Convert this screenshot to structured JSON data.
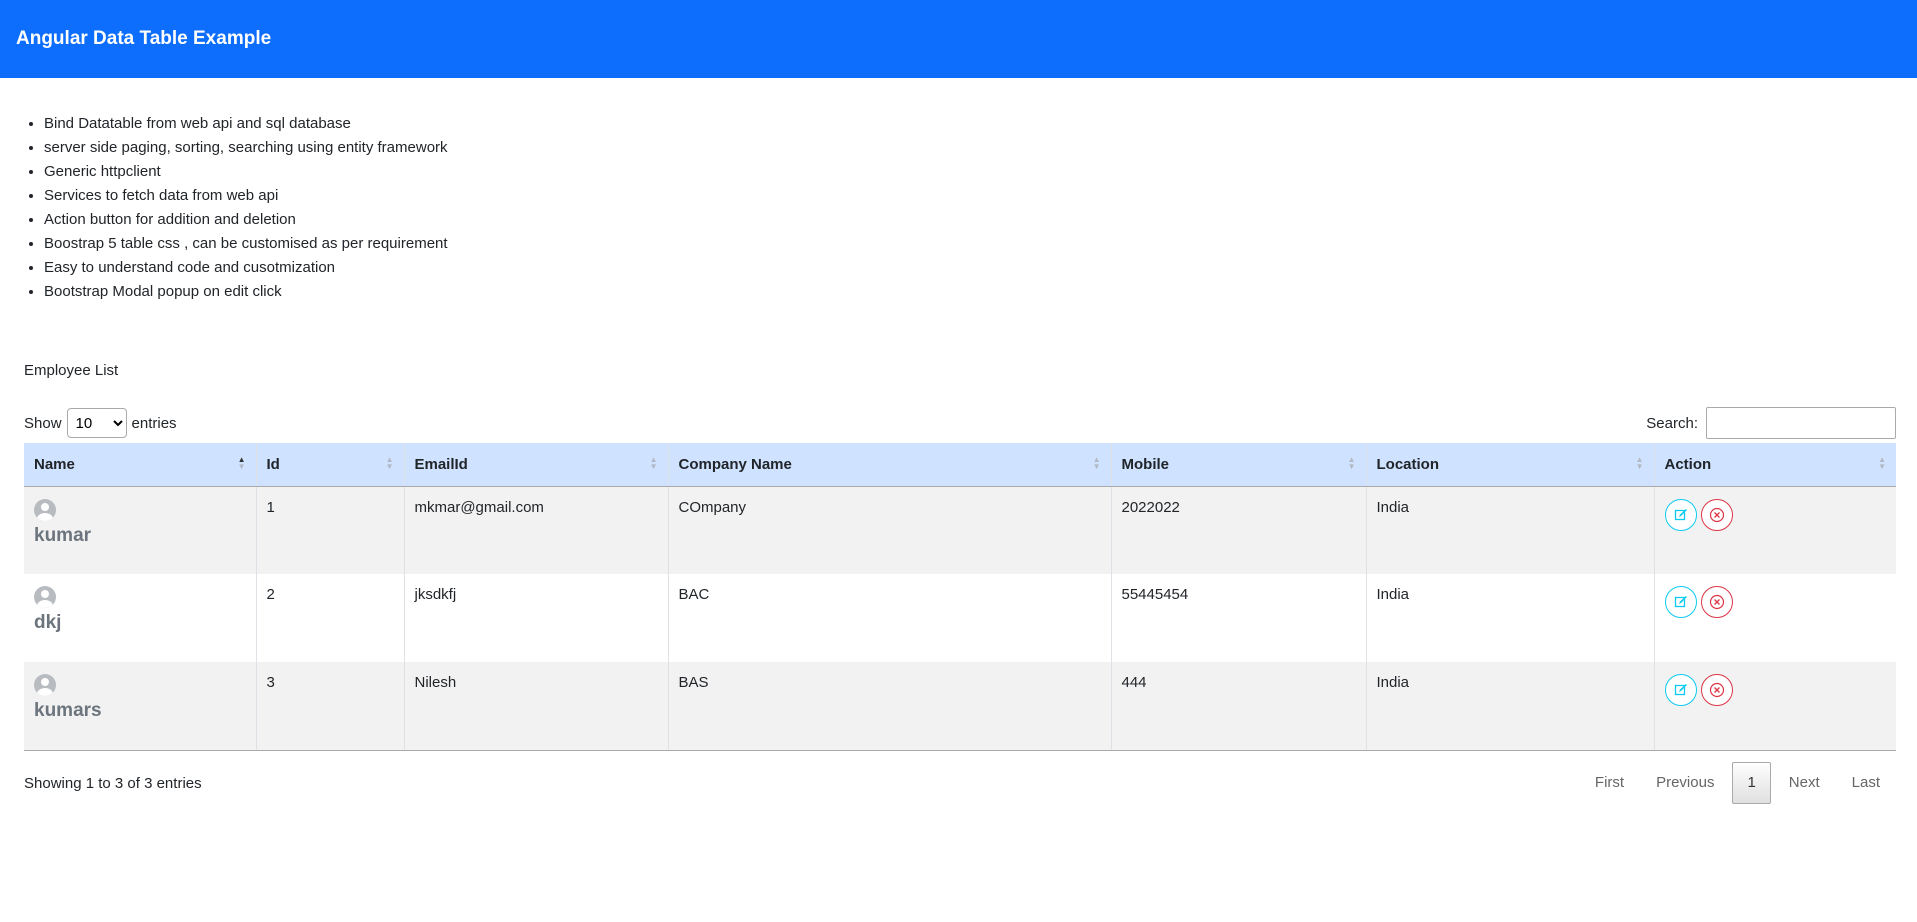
{
  "navbar": {
    "brand": "Angular Data Table Example"
  },
  "features": [
    "Bind Datatable from web api and sql database",
    "server side paging, sorting, searching using entity framework",
    "Generic httpclient",
    "Services to fetch data from web api",
    "Action button for addition and deletion",
    "Boostrap 5 table css , can be customised as per requirement",
    "Easy to understand code and cusotmization",
    "Bootstrap Modal popup on edit click"
  ],
  "section_title": "Employee List",
  "length": {
    "show_label": "Show",
    "value": "10",
    "entries_label": "entries"
  },
  "search": {
    "label": "Search:",
    "value": ""
  },
  "table": {
    "headers": [
      "Name",
      "Id",
      "EmailId",
      "Company Name",
      "Mobile",
      "Location",
      "Action"
    ],
    "rows": [
      {
        "name": "kumar",
        "id": "1",
        "email": "mkmar@gmail.com",
        "company": "COmpany",
        "mobile": "2022022",
        "location": "India"
      },
      {
        "name": "dkj",
        "id": "2",
        "email": "jksdkfj",
        "company": "BAC",
        "mobile": "55445454",
        "location": "India"
      },
      {
        "name": "kumars",
        "id": "3",
        "email": "Nilesh",
        "company": "BAS",
        "mobile": "444",
        "location": "India"
      }
    ]
  },
  "info": "Showing 1 to 3 of 3 entries",
  "pagination": {
    "first": "First",
    "previous": "Previous",
    "current": "1",
    "next": "Next",
    "last": "Last"
  },
  "colors": {
    "brand": "#0d6efd",
    "header_row": "#cfe2ff",
    "edit": "#0dcaf0",
    "delete": "#dc3545"
  },
  "icons": {
    "edit": "edit-icon",
    "delete": "delete-icon",
    "avatar": "user-avatar-icon"
  }
}
